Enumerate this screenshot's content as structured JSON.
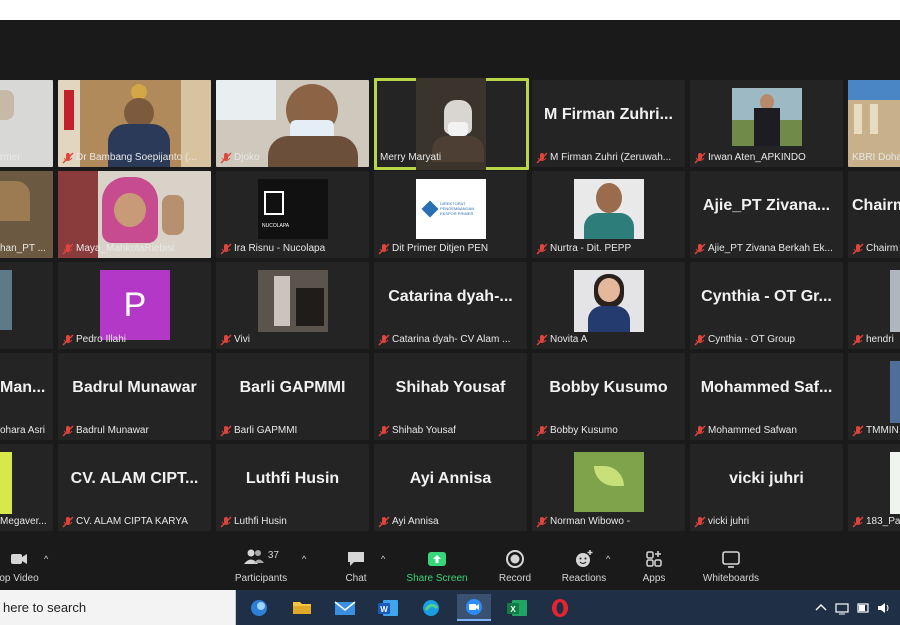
{
  "participants": [
    {
      "label": "rmer",
      "big_name": ""
    },
    {
      "label": "Dr Bambang Soepijanto (...",
      "big_name": ""
    },
    {
      "label": "Djoko",
      "big_name": ""
    },
    {
      "label": "Merry Maryati",
      "big_name": ""
    },
    {
      "label": "M Firman Zuhri (Zeruwah...",
      "big_name": "M Firman Zuhri..."
    },
    {
      "label": "Irwan Aten_APKINDO",
      "big_name": ""
    },
    {
      "label": "KBRI Doha",
      "big_name": ""
    },
    {
      "label": "han_PT ...",
      "big_name": ""
    },
    {
      "label": "Maya_MahkotaRiebisi",
      "big_name": ""
    },
    {
      "label": "Ira Risnu - Nucolapa",
      "big_name": ""
    },
    {
      "label": "Dit Primer Ditjen PEN",
      "big_name": ""
    },
    {
      "label": "Nurtra - Dit. PEPP",
      "big_name": ""
    },
    {
      "label": "Ajie_PT Zivana Berkah Ek...",
      "big_name": "Ajie_PT Zivana..."
    },
    {
      "label": "Chairm",
      "big_name": "Chairm"
    },
    {
      "label": "",
      "big_name": ""
    },
    {
      "label": "Pedro Illahi",
      "big_name": ""
    },
    {
      "label": "Vivi",
      "big_name": ""
    },
    {
      "label": "Catarina dyah- CV Alam ...",
      "big_name": "Catarina dyah-..."
    },
    {
      "label": "Novita A",
      "big_name": ""
    },
    {
      "label": "Cynthia - OT Group",
      "big_name": "Cynthia - OT Gr..."
    },
    {
      "label": "hendri",
      "big_name": ""
    },
    {
      "label": "ohara Asri",
      "big_name": "Man..."
    },
    {
      "label": "Badrul Munawar",
      "big_name": "Badrul Munawar"
    },
    {
      "label": "Barli GAPMMI",
      "big_name": "Barli GAPMMI"
    },
    {
      "label": "Shihab Yousaf",
      "big_name": "Shihab Yousaf"
    },
    {
      "label": "Bobby Kusumo",
      "big_name": "Bobby Kusumo"
    },
    {
      "label": "Mohammed Safwan",
      "big_name": "Mohammed Saf..."
    },
    {
      "label": "TMMIN",
      "big_name": ""
    },
    {
      "label": "Megaver...",
      "big_name": ""
    },
    {
      "label": "CV. ALAM CIPTA KARYA",
      "big_name": "CV. ALAM CIPT..."
    },
    {
      "label": "Luthfi Husin",
      "big_name": "Luthfi Husin"
    },
    {
      "label": "Ayi Annisa",
      "big_name": "Ayi Annisa"
    },
    {
      "label": "Norman Wibowo -",
      "big_name": ""
    },
    {
      "label": "vicki juhri",
      "big_name": "vicki juhri"
    },
    {
      "label": "183_Pa",
      "big_name": ""
    }
  ],
  "avatar_letter": "P",
  "logo_text": {
    "nucolapa": "NUCOLAPA",
    "direktorat": "DIREKTORAT PENGEMBANGAN EKSPOR PRIMER"
  },
  "toolbar": {
    "video_label": "op Video",
    "participants_label": "Participants",
    "participants_count": "37",
    "chat_label": "Chat",
    "share_label": "Share Screen",
    "record_label": "Record",
    "reactions_label": "Reactions",
    "apps_label": "Apps",
    "whiteboards_label": "Whiteboards"
  },
  "taskbar": {
    "search_placeholder": "here to search"
  },
  "colors": {
    "active_speaker": "#b9d54a",
    "share_green": "#37d67a",
    "mute_red": "#e0443a",
    "avatar_purple": "#b438c8"
  }
}
